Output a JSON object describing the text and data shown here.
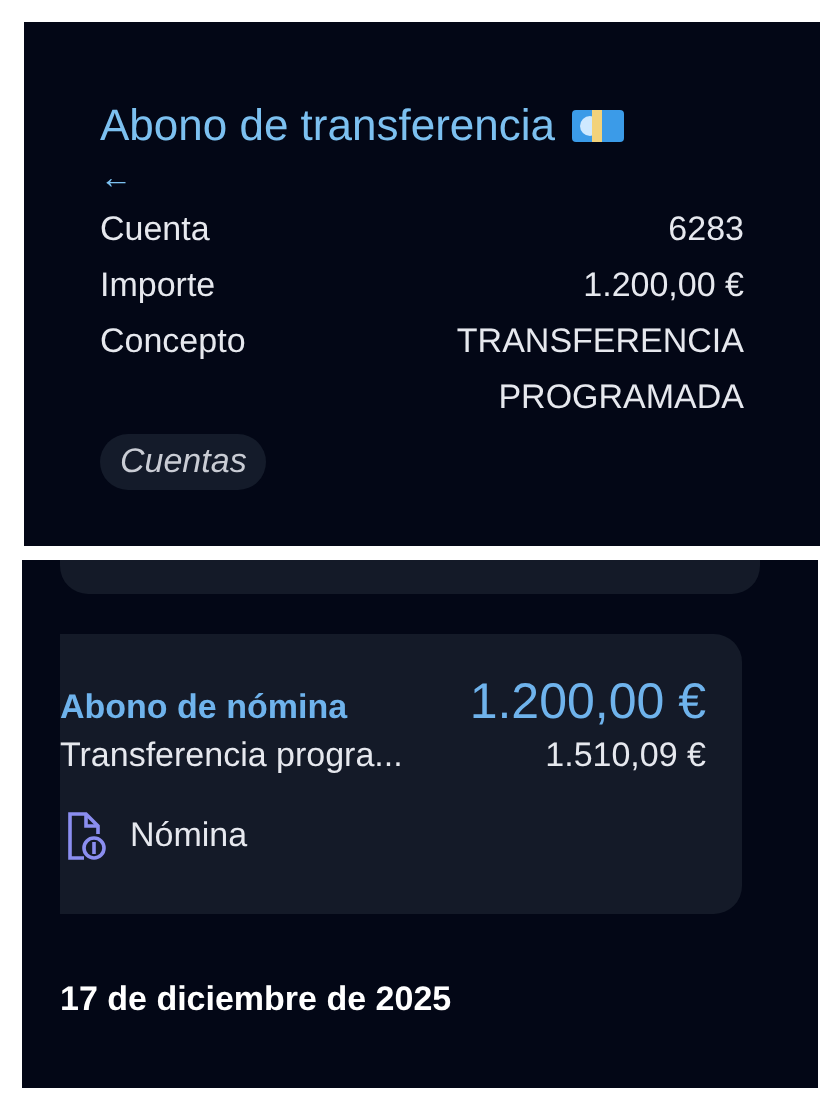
{
  "detail": {
    "title": "Abono de transferencia",
    "back_arrow": "←",
    "rows": [
      {
        "label": "Cuenta",
        "value": "6283"
      },
      {
        "label": "Importe",
        "value": "1.200,00 €"
      },
      {
        "label": "Concepto",
        "value": "TRANSFERENCIA PROGRAMADA"
      }
    ],
    "chip": "Cuentas"
  },
  "movement": {
    "title": "Abono de nómina",
    "amount": "1.200,00 €",
    "description": "Transferencia progra...",
    "balance": "1.510,09 €",
    "category": "Nómina"
  },
  "date_header": "17 de diciembre de 2025"
}
